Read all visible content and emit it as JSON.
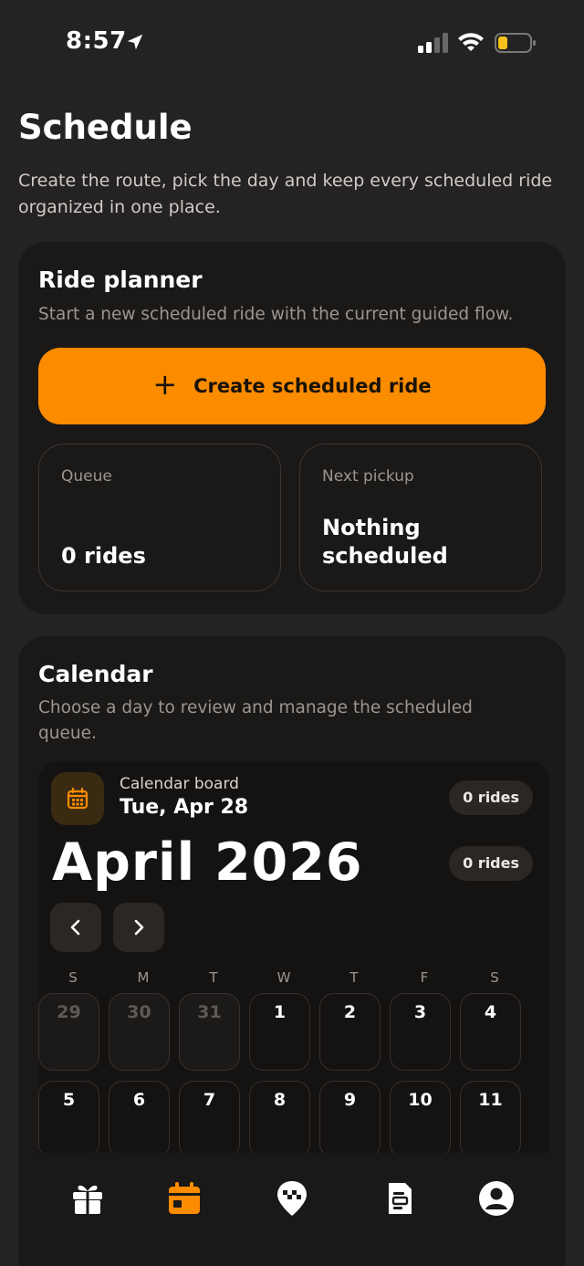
{
  "status_bar": {
    "time": "8:57"
  },
  "header": {
    "title": "Schedule",
    "subtitle": "Create the route, pick the day and keep every scheduled ride organized in one place."
  },
  "planner": {
    "title": "Ride planner",
    "subtitle": "Start a new scheduled ride with the current guided flow.",
    "create_button": "Create scheduled ride",
    "queue_label": "Queue",
    "queue_value": "0 rides",
    "next_label": "Next pickup",
    "next_value": "Nothing scheduled"
  },
  "calendar": {
    "title": "Calendar",
    "subtitle": "Choose a day to review and manage the scheduled queue.",
    "board_label": "Calendar board",
    "selected_date": "Tue, Apr 28",
    "selected_count": "0 rides",
    "month_title": "April 2026",
    "month_count": "0 rides",
    "weekdays": [
      "S",
      "M",
      "T",
      "W",
      "T",
      "F",
      "S"
    ],
    "days": [
      {
        "label": "29",
        "muted": true
      },
      {
        "label": "30",
        "muted": true
      },
      {
        "label": "31",
        "muted": true
      },
      {
        "label": "1",
        "muted": false
      },
      {
        "label": "2",
        "muted": false
      },
      {
        "label": "3",
        "muted": false
      },
      {
        "label": "4",
        "muted": false
      },
      {
        "label": "5",
        "muted": false
      },
      {
        "label": "6",
        "muted": false
      },
      {
        "label": "7",
        "muted": false
      },
      {
        "label": "8",
        "muted": false
      },
      {
        "label": "9",
        "muted": false
      },
      {
        "label": "10",
        "muted": false
      },
      {
        "label": "11",
        "muted": false
      }
    ]
  },
  "tab_bar": {
    "tabs": [
      {
        "icon": "gift-icon",
        "active": false
      },
      {
        "icon": "calendar-icon",
        "active": true
      },
      {
        "icon": "taxi-pin-icon",
        "active": false
      },
      {
        "icon": "receipt-icon",
        "active": false
      },
      {
        "icon": "profile-icon",
        "active": false
      }
    ]
  },
  "colors": {
    "accent": "#fb8c00",
    "background": "#242222",
    "card": "#1b1918"
  }
}
